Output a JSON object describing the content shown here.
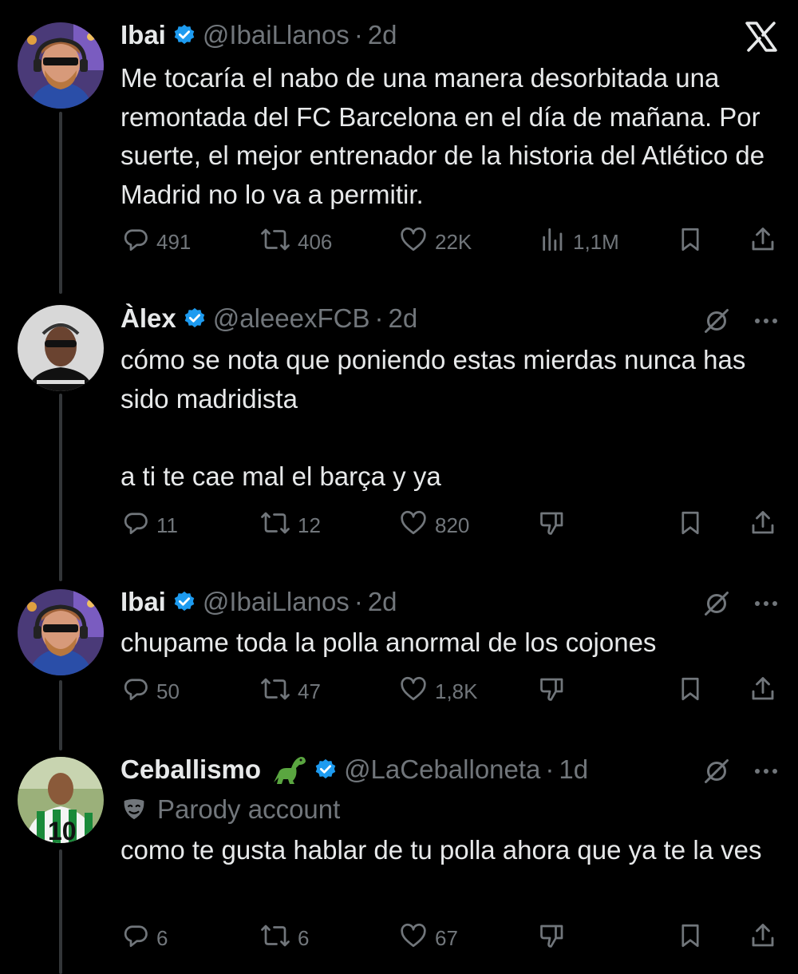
{
  "tweets": [
    {
      "name": "Ibai",
      "handle": "@IbaiLlanos",
      "separator": "·",
      "time": "2d",
      "text": "Me tocaría el nabo de una manera desorbitada una remontada del FC Barcelona en el día de mañana. Por suerte, el mejor entrenador de la historia del Atlético de Madrid no lo va a permitir.",
      "replies": "491",
      "reposts": "406",
      "likes": "22K",
      "views": "1,1M"
    },
    {
      "name": "Àlex",
      "handle": "@aleeexFCB",
      "separator": "·",
      "time": "2d",
      "text": "cómo se nota que poniendo estas mierdas nunca has sido madridista\n\na ti te cae mal el barça y ya",
      "replies": "11",
      "reposts": "12",
      "likes": "820"
    },
    {
      "name": "Ibai",
      "handle": "@IbaiLlanos",
      "separator": "·",
      "time": "2d",
      "text": "chupame toda la polla anormal de los cojones",
      "replies": "50",
      "reposts": "47",
      "likes": "1,8K"
    },
    {
      "name": "Ceballismo",
      "handle": "@LaCeballoneta",
      "separator": "·",
      "time": "1d",
      "parody_label": "Parody account",
      "text": "como te gusta hablar de tu polla ahora que ya te la ves",
      "replies": "6",
      "reposts": "6",
      "likes": "67"
    }
  ],
  "colors": {
    "background": "#000000",
    "text": "#e7e9ea",
    "secondary": "#71767b",
    "verified": "#1d9bf0",
    "thread_line": "#333639"
  },
  "icons": [
    "x-logo-icon",
    "verified-badge-icon",
    "reply-icon",
    "repost-icon",
    "like-icon",
    "views-icon",
    "bookmark-icon",
    "share-icon",
    "grok-icon",
    "more-icon",
    "dislike-icon",
    "dinosaur-emoji-icon",
    "parody-mask-icon"
  ]
}
